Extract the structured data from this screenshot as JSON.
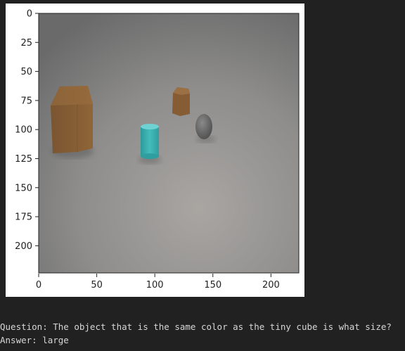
{
  "figure": {
    "x_ticks": [
      "0",
      "50",
      "100",
      "150",
      "200"
    ],
    "y_ticks": [
      "0",
      "25",
      "50",
      "75",
      "100",
      "125",
      "150",
      "175",
      "200"
    ],
    "image_description_objects": [
      {
        "name": "large-brown-cube",
        "color": "#8a5f33"
      },
      {
        "name": "small-brown-cube",
        "color": "#8a5f33"
      },
      {
        "name": "cyan-cylinder",
        "color": "#3fb0b0"
      },
      {
        "name": "gray-sphere",
        "color": "#6e6e6e"
      }
    ]
  },
  "output": {
    "question": "Question: The object that is the same color as the tiny cube is what size?",
    "answer": "Answer: large"
  },
  "colors": {
    "background": "#212121",
    "text": "#d6d6d6",
    "brown": "#8a5f33",
    "cyan": "#3fb0b0"
  }
}
